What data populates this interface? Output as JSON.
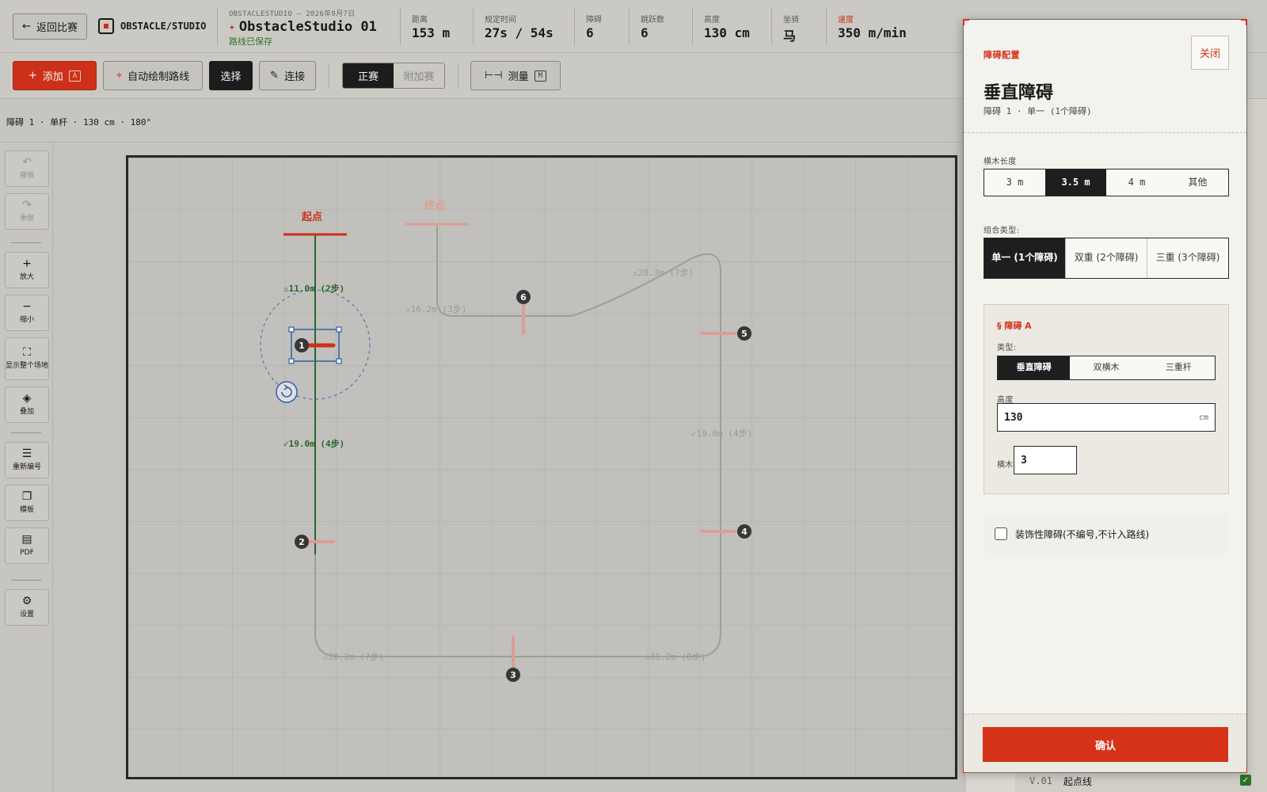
{
  "header": {
    "back_label": "返回比赛",
    "studio_name": "OBSTACLE/STUDIO",
    "doc_date": "OBSTACLESTUDIO — 2026年9月7日",
    "doc_title": "ObstacleStudio 01",
    "saved_status": "路线已保存",
    "stats": [
      {
        "label": "距离",
        "value": "153 m"
      },
      {
        "label": "规定时间",
        "value": "27s / 54s"
      },
      {
        "label": "障碍",
        "value": "6"
      },
      {
        "label": "跳跃数",
        "value": "6"
      },
      {
        "label": "高度",
        "value": "130 cm"
      },
      {
        "label": "坐骑",
        "value": "马"
      },
      {
        "label": "速度",
        "value": "350 m/min"
      }
    ]
  },
  "toolbar": {
    "add_label": "添加",
    "add_key": "A",
    "auto_route_label": "自动绘制路线",
    "select_label": "选择",
    "connect_label": "连接",
    "mode_main": "正赛",
    "mode_jumpoff": "附加赛",
    "measure_label": "测量",
    "measure_key": "M"
  },
  "selection_info": "障碍 1 · 单杆 · 130 cm · 180°",
  "left_tools": {
    "undo": "撤销",
    "redo": "重做",
    "zoom_in": "放大",
    "zoom_out": "缩小",
    "fit": "显示整个场地",
    "overlay": "叠加",
    "renumber": "重新编号",
    "template": "模板",
    "pdf": "PDF",
    "settings": "设置"
  },
  "course": {
    "start_label": "起点",
    "finish_label": "终点",
    "obstacles": [
      "1",
      "2",
      "3",
      "4",
      "5",
      "6"
    ],
    "distances": {
      "start_1": "⚠11.0m (2步)",
      "d_1_2": "✓19.0m (4步)",
      "d_2_3": "⚠28.2m (7步)",
      "d_3_4": "⚠31.2m (8步)",
      "d_4_5": "✓19.0m (4步)",
      "d_5_6": "⚠28.3m (7步)",
      "d_6_f": "⚠16.2m (3步)"
    }
  },
  "background_panel": {
    "row_code": "V.01",
    "row_label": "起点线"
  },
  "dialog": {
    "kicker": "障碍配置",
    "close_label": "关闭",
    "title": "垂直障碍",
    "subtitle": "障碍 1 · 单一 (1个障碍)",
    "rail_length_label": "横木长度",
    "rail_lengths": [
      "3 m",
      "3.5 m",
      "4 m",
      "其他"
    ],
    "rail_length_selected": 1,
    "combo_label": "组合类型:",
    "combos": [
      "单一 (1个障碍)",
      "双重 (2个障碍)",
      "三重 (3个障碍)"
    ],
    "combo_selected": 0,
    "obstacle_a_title": "§ 障碍 A",
    "type_label": "类型:",
    "types": [
      "垂直障碍",
      "双横木",
      "三重杆"
    ],
    "type_selected": 0,
    "height_label": "高度",
    "height_value": "130",
    "height_unit": "cm",
    "rails_label": "横木",
    "rails_value": "3",
    "decorative_label": "装饰性障碍(不编号,不计入路线)",
    "confirm_label": "确认"
  },
  "colors": {
    "accent": "#d6321a",
    "route_active": "#2d6a2d",
    "route_inactive": "#9ea39a",
    "selection": "#3366aa"
  }
}
